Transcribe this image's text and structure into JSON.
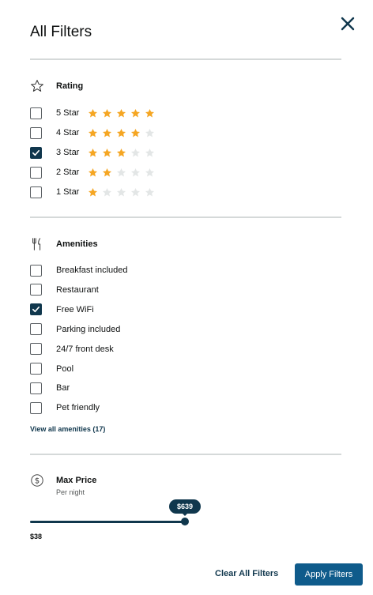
{
  "header": {
    "title": "All Filters",
    "close_icon": "close-icon"
  },
  "colors": {
    "accent": "#10374d",
    "button": "#0f5b8b",
    "star_filled": "#f5a623",
    "star_empty": "#e3e6e6",
    "divider": "#d5d9d9"
  },
  "rating": {
    "heading": "Rating",
    "icon": "star-outline-icon",
    "options": [
      {
        "label": "5 Star",
        "stars": 5,
        "checked": false
      },
      {
        "label": "4 Star",
        "stars": 4,
        "checked": false
      },
      {
        "label": "3 Star",
        "stars": 3,
        "checked": true
      },
      {
        "label": "2 Star",
        "stars": 2,
        "checked": false
      },
      {
        "label": "1 Star",
        "stars": 1,
        "checked": false
      }
    ]
  },
  "amenities": {
    "heading": "Amenities",
    "icon": "utensils-icon",
    "options": [
      {
        "label": "Breakfast included",
        "checked": false
      },
      {
        "label": "Restaurant",
        "checked": false
      },
      {
        "label": "Free WiFi",
        "checked": true
      },
      {
        "label": "Parking included",
        "checked": false
      },
      {
        "label": "24/7 front desk",
        "checked": false
      },
      {
        "label": "Pool",
        "checked": false
      },
      {
        "label": "Bar",
        "checked": false
      },
      {
        "label": "Pet friendly",
        "checked": false
      }
    ],
    "view_all": "View all amenities (17)"
  },
  "price": {
    "heading": "Max Price",
    "subtitle": "Per night",
    "icon": "dollar-circle-icon",
    "current": "$639",
    "min": "$38",
    "fraction": 0.5
  },
  "footer": {
    "clear_label": "Clear All Filters",
    "apply_label": "Apply Filters"
  }
}
